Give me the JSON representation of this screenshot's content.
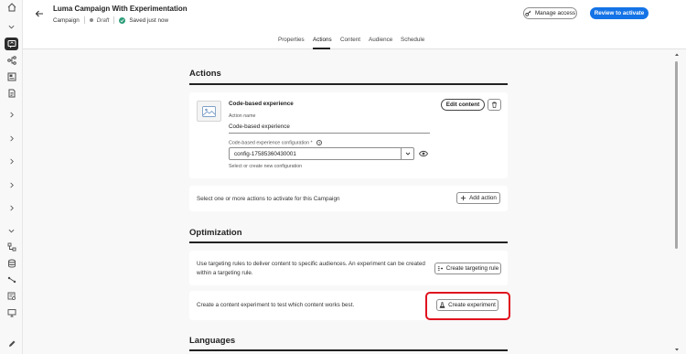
{
  "header": {
    "title": "Luma Campaign With Experimentation",
    "breadcrumb": "Campaign",
    "status": "Draft",
    "saved": "Saved just now",
    "manage_access": "Manage access",
    "review": "Review to activate"
  },
  "tabs": [
    {
      "label": "Properties"
    },
    {
      "label": "Actions"
    },
    {
      "label": "Content"
    },
    {
      "label": "Audience"
    },
    {
      "label": "Schedule"
    }
  ],
  "actions": {
    "heading": "Actions",
    "card_title": "Code-based experience",
    "action_name_label": "Action name",
    "action_name_value": "Code-based experience",
    "config_label": "Code-based experience configuration",
    "config_required": "*",
    "config_value": "config-17585360430001",
    "config_help": "Select or create new configuration",
    "edit_content": "Edit content",
    "add_action_text": "Select one or more actions to activate for this Campaign",
    "add_action": "Add action"
  },
  "optimization": {
    "heading": "Optimization",
    "targeting_text": "Use targeting rules to deliver content to specific audiences. An experiment can be created within a targeting rule.",
    "targeting_button": "Create targeting rule",
    "experiment_text": "Create a content experiment to test which content works best.",
    "experiment_button": "Create experiment"
  },
  "languages": {
    "heading": "Languages"
  },
  "colors": {
    "accent": "#1473e6",
    "highlight": "#e0111e",
    "saved": "#2d9d78"
  },
  "icons": [
    "home-icon",
    "chevron-down-icon",
    "campaign-icon",
    "journey-icon",
    "content-icon",
    "document-icon",
    "chevron-right-icon",
    "workflow-icon",
    "database-icon",
    "connection-icon",
    "query-icon",
    "monitor-icon",
    "edit-icon"
  ]
}
